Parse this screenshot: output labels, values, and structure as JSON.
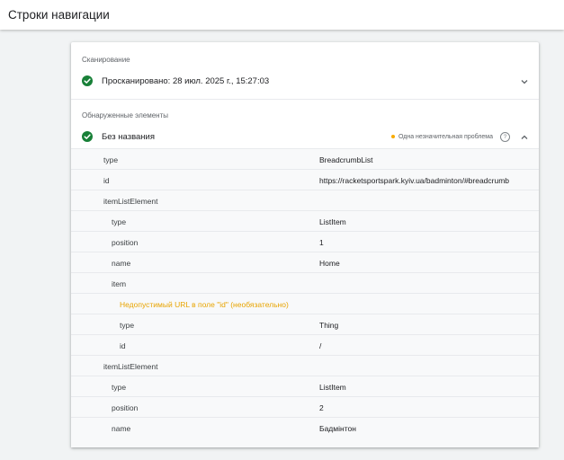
{
  "header": {
    "title": "Строки навигации"
  },
  "scan": {
    "section_label": "Сканирование",
    "status_text": "Просканировано: 28 июл. 2025 г., 15:27:03"
  },
  "detected": {
    "section_label": "Обнаруженные элементы",
    "item_title": "Без названия",
    "issue_label": "Одна незначительная проблема",
    "help_glyph": "?"
  },
  "rows": [
    {
      "key": "type",
      "value": "BreadcrumbList"
    },
    {
      "key": "id",
      "value": "https://racketsportspark.kyiv.ua/badminton/#breadcrumb"
    },
    {
      "key": "itemListElement",
      "value": ""
    },
    {
      "key": "type",
      "value": "ListItem"
    },
    {
      "key": "position",
      "value": "1"
    },
    {
      "key": "name",
      "value": "Home"
    },
    {
      "key": "item",
      "value": ""
    },
    {
      "key": "Недопустимый URL в поле \"id\" (необязательно)",
      "value": ""
    },
    {
      "key": "type",
      "value": "Thing"
    },
    {
      "key": "id",
      "value": "/"
    },
    {
      "key": "itemListElement",
      "value": ""
    },
    {
      "key": "type",
      "value": "ListItem"
    },
    {
      "key": "position",
      "value": "2"
    },
    {
      "key": "name",
      "value": "Бадмінтон"
    }
  ],
  "colors": {
    "success": "#188038",
    "warning": "#f9ab00",
    "warning_text": "#e8a400"
  }
}
